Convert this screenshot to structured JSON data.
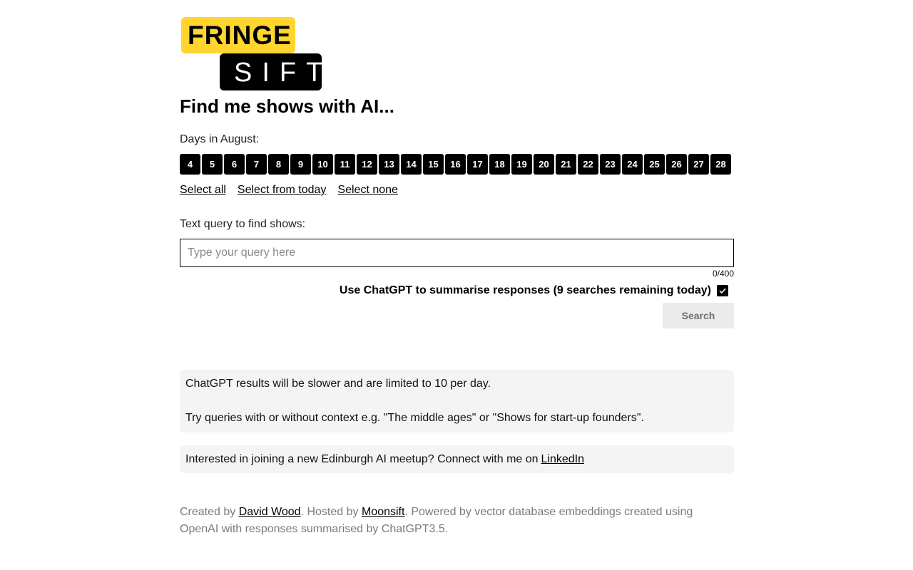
{
  "logo": {
    "top_text": "FRINGE",
    "bottom_text": "SIFT",
    "colors": {
      "yellow": "#ffd52e",
      "black": "#000000"
    }
  },
  "heading": "Find me shows with AI...",
  "days_label": "Days in August:",
  "days": [
    "4",
    "5",
    "6",
    "7",
    "8",
    "9",
    "10",
    "11",
    "12",
    "13",
    "14",
    "15",
    "16",
    "17",
    "18",
    "19",
    "20",
    "21",
    "22",
    "23",
    "24",
    "25",
    "26",
    "27",
    "28"
  ],
  "select_links": {
    "all": "Select all",
    "from_today": "Select from today",
    "none": "Select none"
  },
  "query": {
    "label": "Text query to find shows:",
    "placeholder": "Type your query here",
    "value": "",
    "counter": "0/400"
  },
  "chatgpt_toggle": {
    "label": "Use ChatGPT to summarise responses (9 searches remaining today)",
    "checked": true
  },
  "search_button": "Search",
  "info_box": {
    "line1": "ChatGPT results will be slower and are limited to 10 per day.",
    "line2": "Try queries with or without context e.g. \"The middle ages\" or \"Shows for start-up founders\"."
  },
  "meetup": {
    "text": "Interested in joining a new Edinburgh AI meetup? Connect with me on",
    "link": "LinkedIn"
  },
  "footer": {
    "created_by": "Created by",
    "author": "David Wood",
    "hosted_by": ". Hosted by",
    "host": "Moonsift",
    "powered": ". Powered by vector database embeddings created using OpenAI with responses summarised by ChatGPT3.5."
  }
}
